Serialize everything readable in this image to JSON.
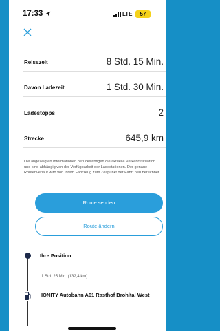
{
  "status_bar": {
    "time": "17:33",
    "location_icon": "location-arrow-icon",
    "carrier": "LTE",
    "battery": "57",
    "battery_color": "#f5d21a"
  },
  "header": {
    "close_icon": "close-icon"
  },
  "summary": [
    {
      "label": "Reisezeit",
      "value": "8 Std. 15 Min."
    },
    {
      "label": "Davon Ladezeit",
      "value": "1 Std. 30 Min."
    },
    {
      "label": "Ladestopps",
      "value": "2"
    },
    {
      "label": "Strecke",
      "value": "645,9 km"
    }
  ],
  "note": "Die angezeigten Informationen berücksichtigen die aktuelle Verkehrssituation und sind abhängig von der Verfügbarkeit der Ladestationen. Der genaue Routenverlauf wird von Ihrem Fahrzeug zum Zeitpunkt der Fahrt neu berechnet.",
  "actions": {
    "send_route": "Route senden",
    "change_route": "Route ändern"
  },
  "route": {
    "start_label": "Ihre Position",
    "leg_1": "1 Std. 25 Min. (132,4 km)",
    "stop_1": "IONITY Autobahn A61 Rasthof Brohltal West",
    "stop_icon": "charging-station-icon"
  },
  "colors": {
    "accent": "#2a9edb",
    "background": "#168fc6"
  }
}
